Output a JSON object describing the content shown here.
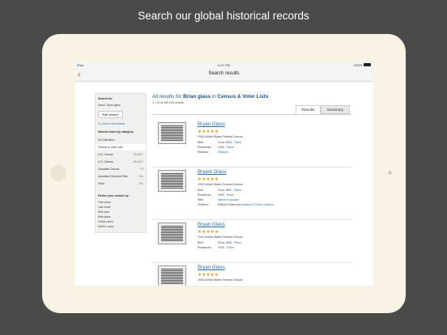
{
  "headline": "Search our global historical records",
  "status_bar": {
    "device": "iPad",
    "time": "4:21 PM",
    "battery": "100%"
  },
  "nav": {
    "back_icon": "chevron-left",
    "title": "Search results"
  },
  "sidebar": {
    "search_for_label": "Search for",
    "name_line": "Name: Brian glass",
    "edit_button": "Edit search",
    "new_search_link": "Or, start a new search",
    "narrow_label": "Narrow down by category",
    "categories": [
      {
        "label": "All Collections",
        "count": ""
      },
      {
        "label": "Census & Voter Lists",
        "count": ""
      },
      {
        "label": "U.S. Census",
        "count": "55,000+"
      },
      {
        "label": "U.S. Census",
        "count": "55,000+"
      },
      {
        "label": "Canadian Census",
        "count": "79"
      },
      {
        "label": "Australian Electoral Rolls",
        "count": "341"
      },
      {
        "label": "Other",
        "count": "181"
      }
    ],
    "refine_label": "Refine your search by:",
    "refine_items": [
      "First name",
      "Last name",
      "Birth year",
      "Birth place",
      "Father name",
      "Mother name"
    ]
  },
  "main": {
    "title_prefix": "All results for",
    "title_name": "Brian glass",
    "title_in": "in",
    "title_collection": "Census & Voter Lists",
    "subtitle": "1 - 20 of 190,243 results",
    "tabs": {
      "results": "Results",
      "summary": "Summary"
    }
  },
  "records": [
    {
      "name": "Bryan Glass",
      "stars": "★★★★★",
      "collection": "1940 United States Federal Census",
      "fields": [
        {
          "label": "Birth:",
          "value": "Circa 1903",
          "link": "Place"
        },
        {
          "label": "Residence:",
          "value": "1940",
          "link": "Place"
        },
        {
          "label": "Relation:",
          "value": "",
          "link": "Relation"
        }
      ]
    },
    {
      "name": "Bryant Glass",
      "stars": "★★★★★",
      "collection": "1940 United States Federal Census",
      "fields": [
        {
          "label": "Birth:",
          "value": "Circa 1891",
          "link": "Place"
        },
        {
          "label": "Residence:",
          "value": "1940",
          "link": "Place"
        },
        {
          "label": "Wife:",
          "value": "",
          "link": "Name of spouse"
        },
        {
          "label": "Children:",
          "value": "Mildred Glass and",
          "link": "names of 2 more children"
        }
      ]
    },
    {
      "name": "Bryan Glass",
      "stars": "★★★★★",
      "collection": "1940 United States Federal Census",
      "fields": [
        {
          "label": "Birth:",
          "value": "Circa 1908",
          "link": "Place"
        },
        {
          "label": "Residence:",
          "value": "1940",
          "link": "Place"
        }
      ]
    },
    {
      "name": "Bryan Glass",
      "stars": "★★★★★",
      "collection": "1940 United States Federal Census",
      "fields": []
    }
  ]
}
